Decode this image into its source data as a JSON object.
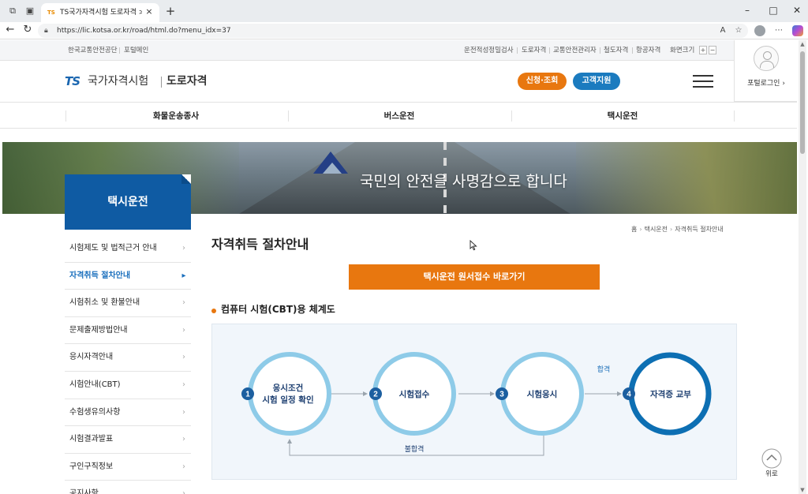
{
  "browser": {
    "tab_title": "TS국가자격시험 도로자격 > 택시운전",
    "url": "https://lic.kotsa.or.kr/road/html.do?menu_idx=37"
  },
  "util_left": [
    "한국교통안전공단",
    "포털메인"
  ],
  "util_right": [
    "운전적성정밀검사",
    "도로자격",
    "교통안전관리자",
    "철도자격",
    "항공자격",
    "화면크기"
  ],
  "header": {
    "logo_mark": "TS",
    "logo_name": "국가자격시험",
    "logo_sub": "도로자격",
    "apply_btn": "신청·조회",
    "support_btn": "고객지원",
    "login_label": "포털로그인 ›"
  },
  "main_nav": [
    "화물운송종사",
    "버스운전",
    "택시운전"
  ],
  "banner": {
    "slogan": "국민의 안전을 사명감으로 합니다"
  },
  "sidebar": {
    "title": "택시운전",
    "items": [
      {
        "label": "시험제도 및 법적근거 안내",
        "active": false
      },
      {
        "label": "자격취득 절차안내",
        "active": true
      },
      {
        "label": "시험취소 및 환불안내",
        "active": false
      },
      {
        "label": "문제출제방법안내",
        "active": false
      },
      {
        "label": "응시자격안내",
        "active": false
      },
      {
        "label": "시험안내(CBT)",
        "active": false
      },
      {
        "label": "수험생유의사항",
        "active": false
      },
      {
        "label": "시험결과발표",
        "active": false
      },
      {
        "label": "구인구직정보",
        "active": false
      },
      {
        "label": "공지사항",
        "active": false
      }
    ]
  },
  "breadcrumb": [
    "홈",
    "택시운전",
    "자격취득 절차안내"
  ],
  "page_title": "자격취득 절차안내",
  "cta_label": "택시운전 원서접수 바로가기",
  "section_heading": "컴퓨터 시험(CBT)용 체계도",
  "flow": {
    "steps": [
      {
        "num": "1",
        "label_line1": "응시조건",
        "label_line2": "시험 일정 확인"
      },
      {
        "num": "2",
        "label_line1": "시험접수",
        "label_line2": ""
      },
      {
        "num": "3",
        "label_line1": "시험응시",
        "label_line2": ""
      },
      {
        "num": "4",
        "label_line1": "자격증 교부",
        "label_line2": ""
      }
    ],
    "pass_label": "합격",
    "fail_label": "불합격"
  },
  "top_button_label": "위로",
  "colors": {
    "accent_orange": "#e8770f",
    "brand_blue": "#0f5ba3",
    "step_light_blue": "#8ecbe8",
    "step_dark_blue": "#0d6fb3"
  }
}
